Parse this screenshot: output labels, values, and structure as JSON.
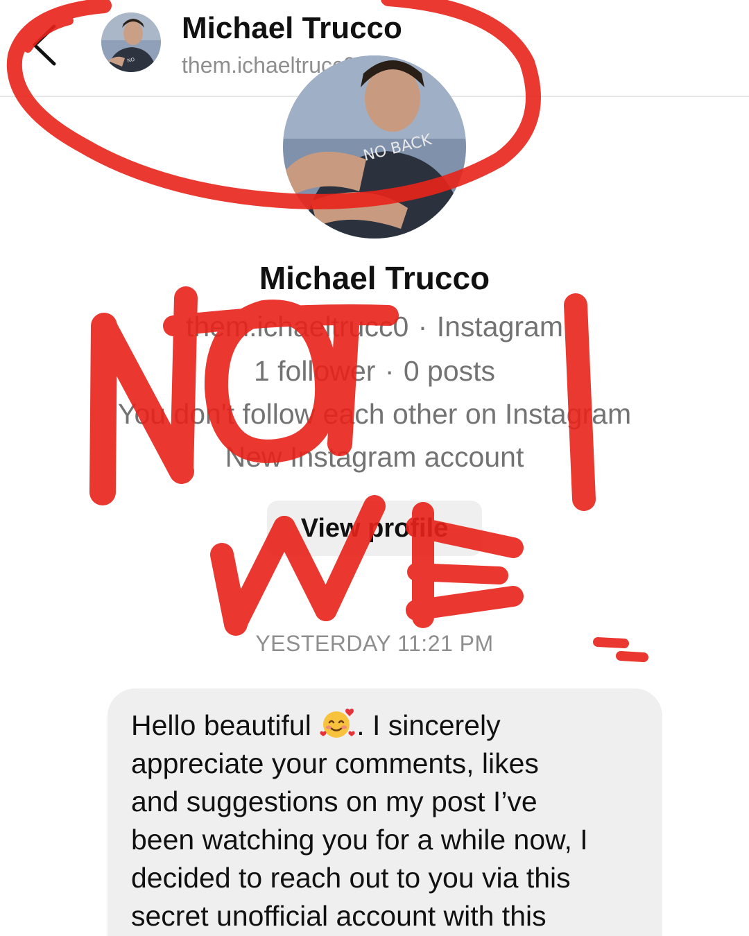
{
  "header": {
    "back_icon": "chevron-left-icon",
    "name": "Michael Trucco",
    "username": "them.ichaeltrucc0"
  },
  "profile": {
    "name": "Michael Trucco",
    "username": "them.ichaeltrucc0",
    "platform": "Instagram",
    "followers": "1 follower",
    "posts": "0 posts",
    "follow_status": "You don't follow each other on Instagram",
    "account_note": "New Instagram account",
    "view_profile_label": "View profile",
    "shirt_text": "NO BACK"
  },
  "conversation": {
    "timestamp": "YESTERDAY 11:21 PM",
    "message_before_emoji": "Hello beautiful ",
    "emoji_name": "smiling-face-with-hearts-icon",
    "message_after_emoji": ". I sincerely\nappreciate your comments, likes\nand suggestions on my post I’ve\nbeen watching you for a while now, I\ndecided to reach out to you via this\nsecret unofficial account with this"
  },
  "annotation": {
    "text": "NOT ME",
    "color": "#e8231a"
  },
  "colors": {
    "secondary_text": "#8e8e8e",
    "bubble_bg": "#efefef",
    "button_bg": "#efefef"
  }
}
